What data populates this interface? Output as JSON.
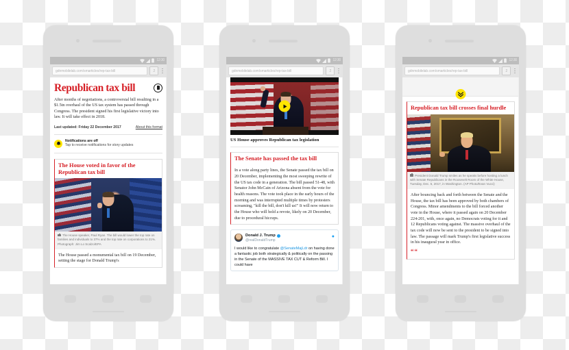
{
  "meta": {
    "accent_red": "#d61f26",
    "accent_yellow": "#ffe500",
    "twitter_blue": "#1da1f2",
    "frame_grey": "#dedede"
  },
  "browser": {
    "url": "gdnmobilelab.com/smarticles/rep-tax-bill",
    "tab_count": "2",
    "status_time": "12:30",
    "icons": {
      "wifi": "wifi-icon",
      "signal": "signal-icon",
      "battery": "battery-icon",
      "menu": "kebab-menu-icon",
      "tabs": "tab-switcher-icon"
    }
  },
  "phone1": {
    "article": {
      "title": "Republican tax bill",
      "logo": "guardian-logo",
      "standfirst": "After months of negotiations, a controversial bill resulting in a $1.5tn overhaul of the US tax system has passed through Congress. The president signed his first legislative victory into law. It will take effect in 2018.",
      "last_updated": "Last updated: Friday 22 December 2017",
      "about_link": "About this format"
    },
    "notification": {
      "icon": "notification-bell-icon",
      "title": "Notifications are off",
      "subtitle": "Tap to receive notifications for story updates"
    },
    "story": {
      "headline": "The House voted in favor of the Republican tax bill",
      "image_alt": "paul-ryan-photo",
      "caption": "The House speaker, Paul Ryan. The bill would lower the top rate on families and individuals to 37% and the top rate on corporations to 21%. Photograph: Jim Lo Scalzo/EPA",
      "body": "The House passed a monumental tax bill on 19 December, setting the stage for Donald Trump's"
    }
  },
  "phone2": {
    "video": {
      "play_icon": "play-button-icon",
      "caption": "US House approves Republican tax legislation",
      "image_alt": "us-house-vote-video"
    },
    "story": {
      "headline": "The Senate has passed the tax bill",
      "body": "In a vote along party lines, the Senate passed the tax bill on 20 December, implementing the most sweeping rewrite of the US tax code in a generation. The bill passed 51-48, with Senator John McCain of Arizona absent from the vote for health reasons. The vote took place in the early hours of the morning and was interrupted multiple times by protesters screaming, \"kill the bill, don't kill us!\" It will now return to the House who will hold a revote, likely on 20 December, due to procedural hiccups."
    },
    "tweet": {
      "author": "Donald J. Trump",
      "handle": "@realDonaldTrump",
      "verified": "verified-badge-icon",
      "bird": "twitter-bird-icon",
      "text_1": "I would like to congratulate ",
      "mention": "@SenateMajLdr",
      "text_2": " on having done a fantastic job both strategically & politically on the passing in the Senate of the MASSIVE TAX CUT & Reform Bill. I could have"
    }
  },
  "phone3": {
    "jump_button": "jump-to-latest-icon",
    "story": {
      "headline": "Republican tax bill crosses final hurdle",
      "image_alt": "donald-trump-photo",
      "caption": "President Donald Trump smiles as he speaks before hosting a lunch with Senate Republicans in the Roosevelt Room of the White House, Tuesday, Dec. 5, 2017, in Washington. (AP Photo/Evan Vucci)",
      "body": "After bouncing back and forth between the Senate and the House, the tax bill has been approved by both chambers of Congress. Minor amendments to the bill forced another vote in the House, where it passed again on 20 December 224-201, with, once again, no Democrats voting for it and 12 Republicans voting against. The massive overhaul of the tax code will now be sent to the president to be signed into law. The passage will mark Trump's first legislative success in his inaugural year in office.",
      "quote_mark": "““"
    }
  }
}
